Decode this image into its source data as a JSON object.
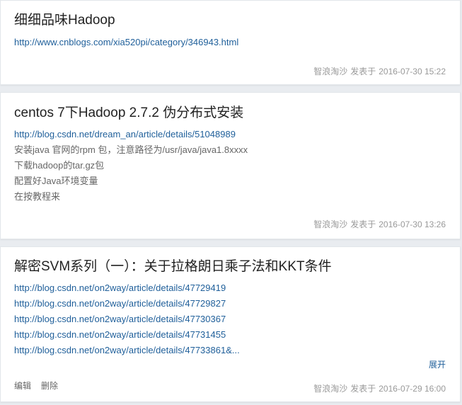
{
  "posts": [
    {
      "title": "细细品味Hadoop",
      "links": [
        "http://www.cnblogs.com/xia520pi/category/346943.html"
      ],
      "lines": [],
      "author": "智浪淘沙",
      "verb": "发表于",
      "datetime": "2016-07-30 15:22"
    },
    {
      "title": "centos 7下Hadoop 2.7.2 伪分布式安装",
      "links": [
        "http://blog.csdn.net/dream_an/article/details/51048989"
      ],
      "lines": [
        "安装java 官网的rpm 包，注意路径为/usr/java/java1.8xxxx",
        "下载hadoop的tar.gz包",
        "配置好Java环境变量",
        "在按教程来"
      ],
      "author": "智浪淘沙",
      "verb": "发表于",
      "datetime": "2016-07-30 13:26"
    },
    {
      "title": "解密SVM系列（一）：关于拉格朗日乘子法和KKT条件",
      "links": [
        "http://blog.csdn.net/on2way/article/details/47729419",
        "http://blog.csdn.net/on2way/article/details/47729827",
        "http://blog.csdn.net/on2way/article/details/47730367",
        "http://blog.csdn.net/on2way/article/details/47731455",
        "http://blog.csdn.net/on2way/article/details/47733861&..."
      ],
      "lines": [],
      "expand_label": "展开",
      "edit_label": "编辑",
      "delete_label": "删除",
      "author": "智浪淘沙",
      "verb": "发表于",
      "datetime": "2016-07-29 16:00"
    }
  ]
}
